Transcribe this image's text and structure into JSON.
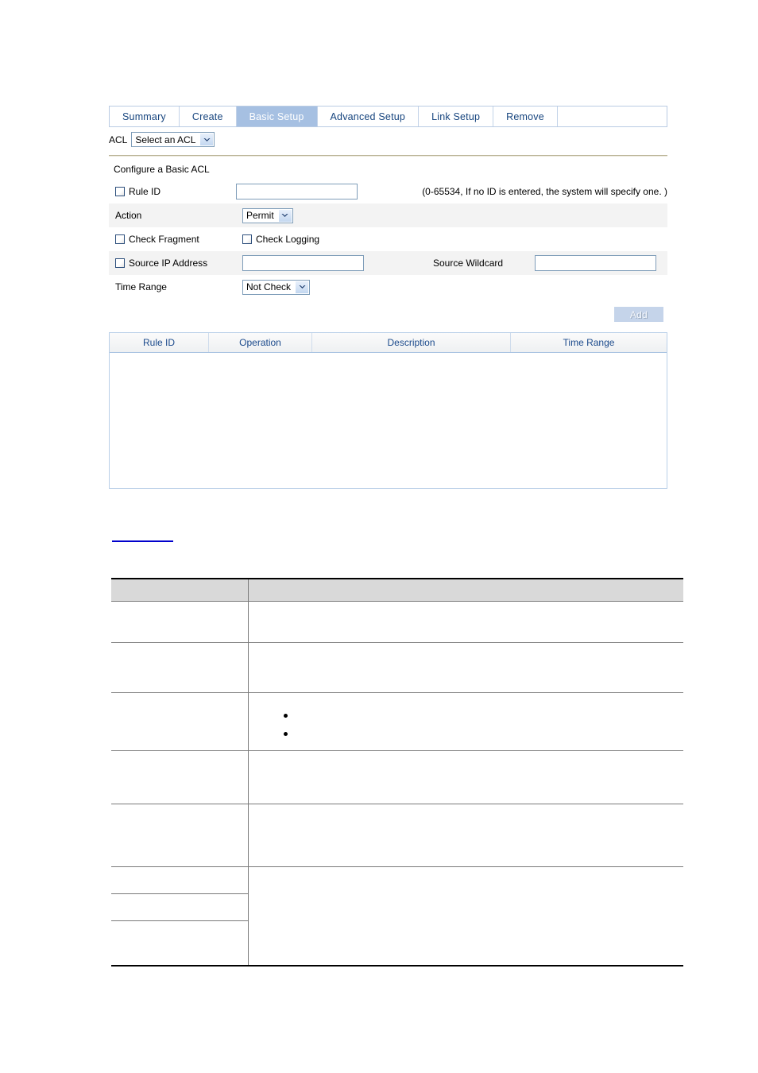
{
  "tabs": [
    {
      "label": "Summary",
      "active": false
    },
    {
      "label": "Create",
      "active": false
    },
    {
      "label": "Basic Setup",
      "active": true
    },
    {
      "label": "Advanced Setup",
      "active": false
    },
    {
      "label": "Link Setup",
      "active": false
    },
    {
      "label": "Remove",
      "active": false
    }
  ],
  "acl_selector": {
    "label": "ACL",
    "value": "Select an ACL"
  },
  "form": {
    "title": "Configure a Basic ACL",
    "rule_id": {
      "checkbox_label": "Rule ID",
      "value": "",
      "hint": "(0-65534, If no ID is entered, the system will specify one. )"
    },
    "action": {
      "label": "Action",
      "value": "Permit"
    },
    "check_fragment_label": "Check Fragment",
    "check_logging_label": "Check Logging",
    "source_ip": {
      "checkbox_label": "Source IP Address",
      "value": ""
    },
    "source_wildcard": {
      "label": "Source Wildcard",
      "value": ""
    },
    "time_range": {
      "label": "Time Range",
      "value": "Not Check"
    },
    "add_button_label": "Add"
  },
  "results_table": {
    "columns": [
      "Rule ID",
      "Operation",
      "Description",
      "Time Range"
    ],
    "rows": []
  },
  "doc_table": {
    "header_cells": [
      "",
      ""
    ],
    "rows": [
      {
        "cells": [
          "",
          ""
        ]
      },
      {
        "cells": [
          "",
          ""
        ]
      },
      {
        "cells": [
          "",
          ""
        ],
        "bullets": 2
      },
      {
        "cells": [
          "",
          ""
        ]
      },
      {
        "cells": [
          "",
          ""
        ]
      },
      {
        "cells": [
          "",
          ""
        ]
      },
      {
        "cells": [
          "",
          ""
        ]
      },
      {
        "cells": [
          "",
          ""
        ]
      }
    ]
  },
  "colors": {
    "tab_active_bg": "#a6c0e2",
    "tab_text": "#16447e",
    "table_header_text": "#1b4a8c",
    "table_border": "#b9cfe8",
    "row_shade": "#f3f3f3",
    "divider_tan": "#b9b396",
    "doc_header_bg": "#d9d9d9",
    "link_blue": "#0000cc",
    "button_disabled_bg": "#c5d4ea"
  }
}
